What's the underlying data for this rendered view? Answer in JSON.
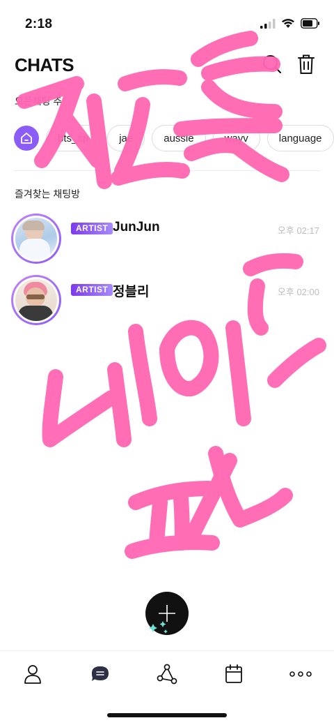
{
  "status_bar": {
    "time": "2:18"
  },
  "header": {
    "title": "CHATS"
  },
  "open_chat_section": {
    "label": "오픈채팅 추"
  },
  "chips": [
    "bts_sp",
    "jae",
    "aussie",
    "wayv",
    "language"
  ],
  "favorites_section": {
    "label": "즐겨찾는 채팅방"
  },
  "chats": [
    {
      "badge": "ARTIST",
      "name": "JunJun",
      "time": "오후 02:17"
    },
    {
      "badge": "ARTIST",
      "name": "정블리",
      "time": "오후 02:00"
    }
  ],
  "tabbar": {
    "items": [
      {
        "icon": "person-icon"
      },
      {
        "icon": "chat-bubble-icon"
      },
      {
        "icon": "share-nodes-icon"
      },
      {
        "icon": "calendar-icon"
      },
      {
        "icon": "more-dots-icon"
      }
    ]
  },
  "colors": {
    "accent": "#8b5cf6",
    "annotation": "#ff66b2",
    "badge_start": "#7c3aed",
    "badge_end": "#a78bfa"
  }
}
